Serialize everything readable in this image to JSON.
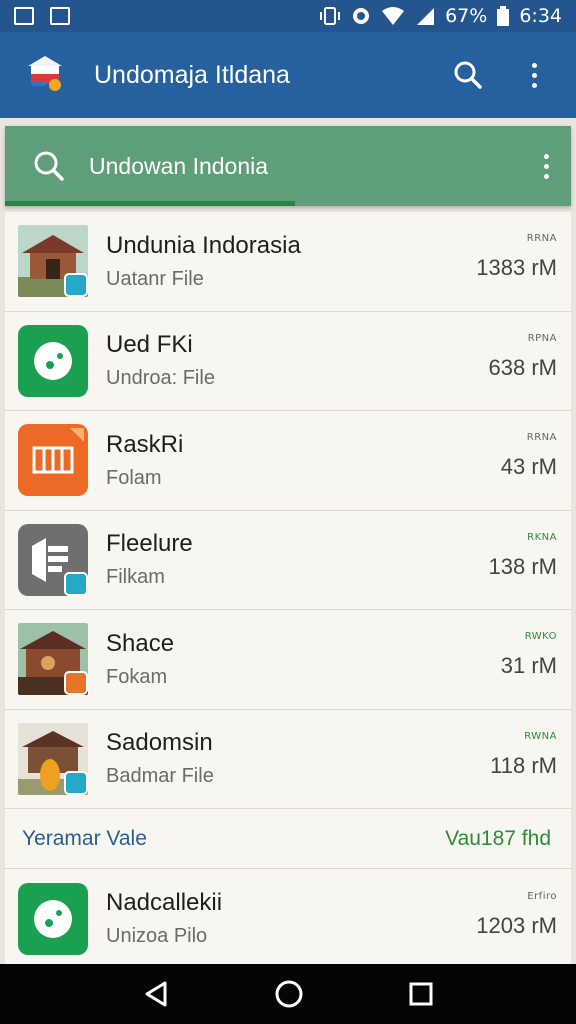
{
  "status_bar": {
    "battery": "67%",
    "time": "6:34",
    "icons": [
      "image-icon",
      "gallery-icon",
      "vibrate-icon",
      "sync-icon",
      "wifi-icon",
      "signal-icon",
      "battery-icon"
    ]
  },
  "app_bar": {
    "title": "Undomaja Itldana",
    "icons": [
      "app-logo-icon",
      "search-icon",
      "more-vert-icon"
    ]
  },
  "search": {
    "query": "Undowan Indonia"
  },
  "items": [
    {
      "title": "Undunia Indorasia",
      "subtitle": "Uatanr File",
      "meta_small": "RRNA",
      "size": "1383 rM",
      "thumb": "pavilion-photo",
      "badge_color": "#26a9c8"
    },
    {
      "title": "Ued FKi",
      "subtitle": "Undroa: File",
      "meta_small": "RPNA",
      "size": "638 rM",
      "thumb": "green-app",
      "badge_color": ""
    },
    {
      "title": "RaskRi",
      "subtitle": "Folam",
      "meta_small": "RRNA",
      "size": "43 rM",
      "thumb": "orange-app",
      "badge_color": ""
    },
    {
      "title": "Fleelure",
      "subtitle": "Filkam",
      "meta_small": "RKNA",
      "size": "138 rM",
      "thumb": "gray-app",
      "badge_color": "#26a9c8"
    },
    {
      "title": "Shace",
      "subtitle": "Fokam",
      "meta_small": "RWKO",
      "size": "31 rM",
      "thumb": "pavilion-photo-2",
      "badge_color": "#e8742a"
    },
    {
      "title": "Sadomsin",
      "subtitle": "Badmar File",
      "meta_small": "RWNA",
      "size": "118 rM",
      "thumb": "pavilion-photo-3",
      "badge_color": "#26a9c8"
    }
  ],
  "section": {
    "left": "Yeramar Vale",
    "right": "Vau187 fhd"
  },
  "last_item": {
    "title": "Nadcallekii",
    "subtitle": "Unizoa Pilo",
    "meta_small": "Erfiro",
    "size": "1203 rM",
    "thumb": "green-app"
  },
  "nav_bar": {
    "icons": [
      "back-icon",
      "home-icon",
      "recents-icon"
    ]
  },
  "colors": {
    "app_bar": "#26609f",
    "status_bar": "#24558f",
    "search_bar": "#5e9e78",
    "accent_green": "#2e8b3e",
    "list_bg": "#f8f6f0"
  }
}
